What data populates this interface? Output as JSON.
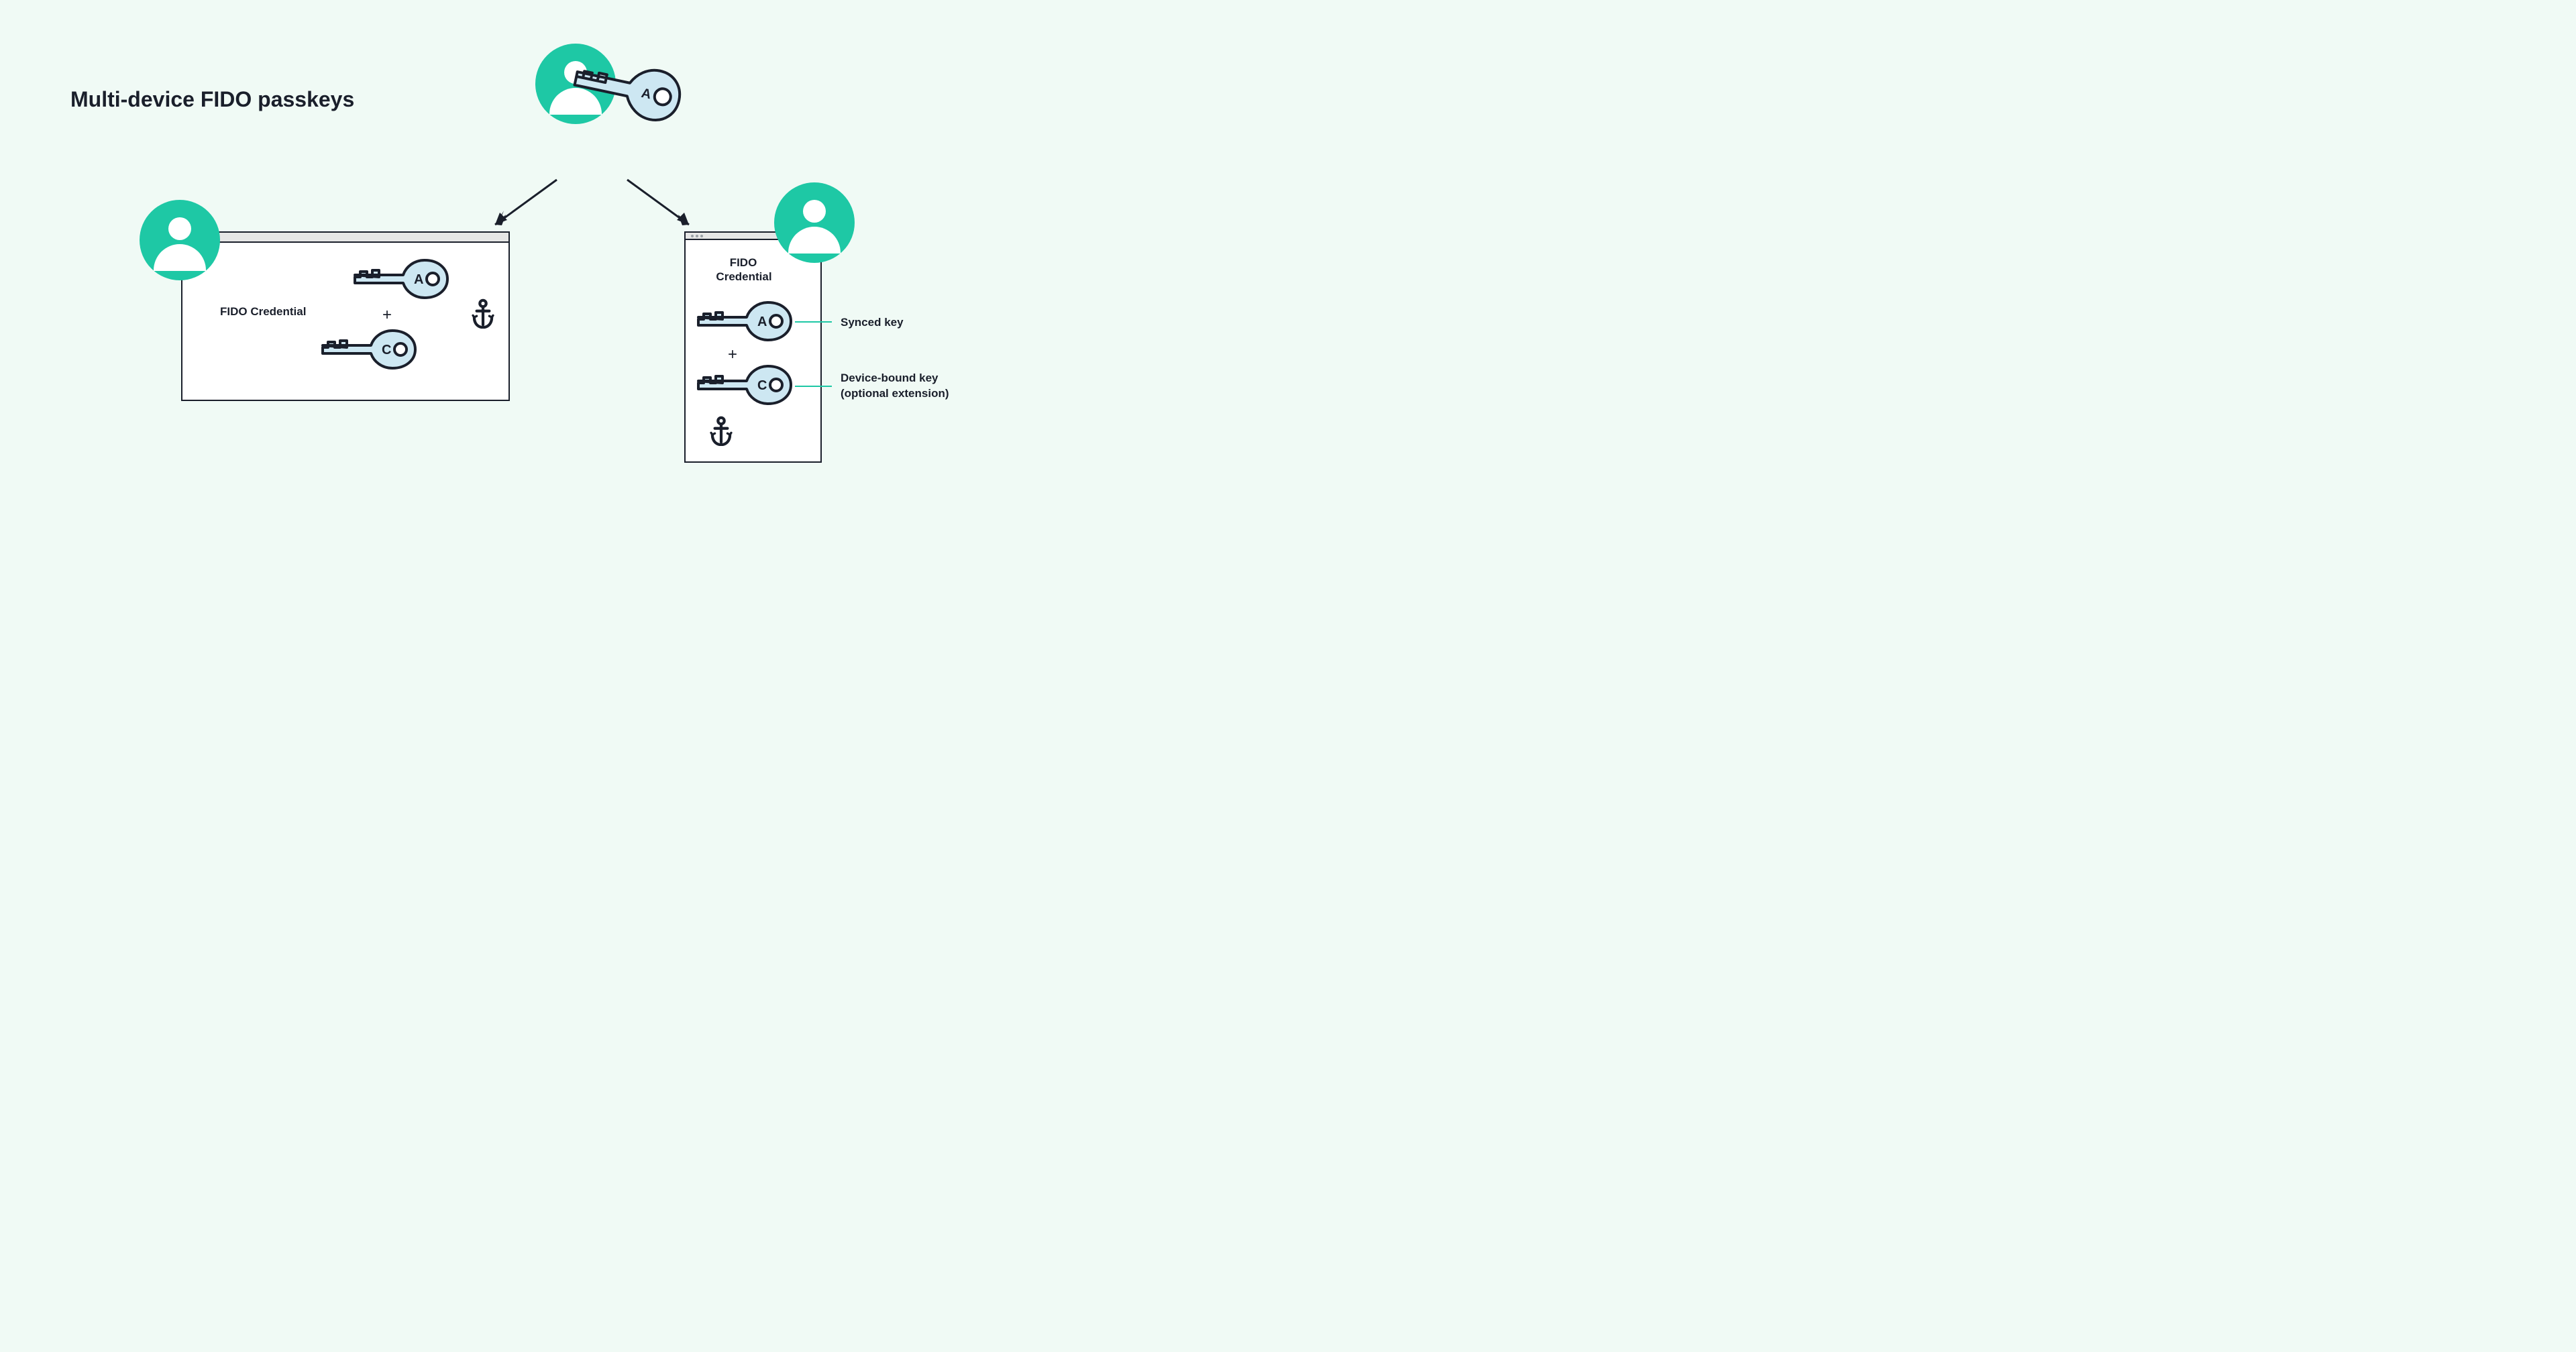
{
  "title": "Multi-device FIDO passkeys",
  "colors": {
    "accent": "#1ec8a5",
    "ink": "#1a1f2b",
    "key_fill": "#cde7f2",
    "bg": "#f0faf5"
  },
  "top": {
    "key_letter": "A"
  },
  "left_device": {
    "label": "FIDO Credential",
    "key_a": "A",
    "plus": "+",
    "key_c": "C"
  },
  "right_device": {
    "label_line1": "FIDO",
    "label_line2": "Credential",
    "key_a": "A",
    "plus": "+",
    "key_c": "C"
  },
  "legend": {
    "synced": "Synced key",
    "device_bound_line1": "Device-bound key",
    "device_bound_line2": "(optional extension)"
  }
}
